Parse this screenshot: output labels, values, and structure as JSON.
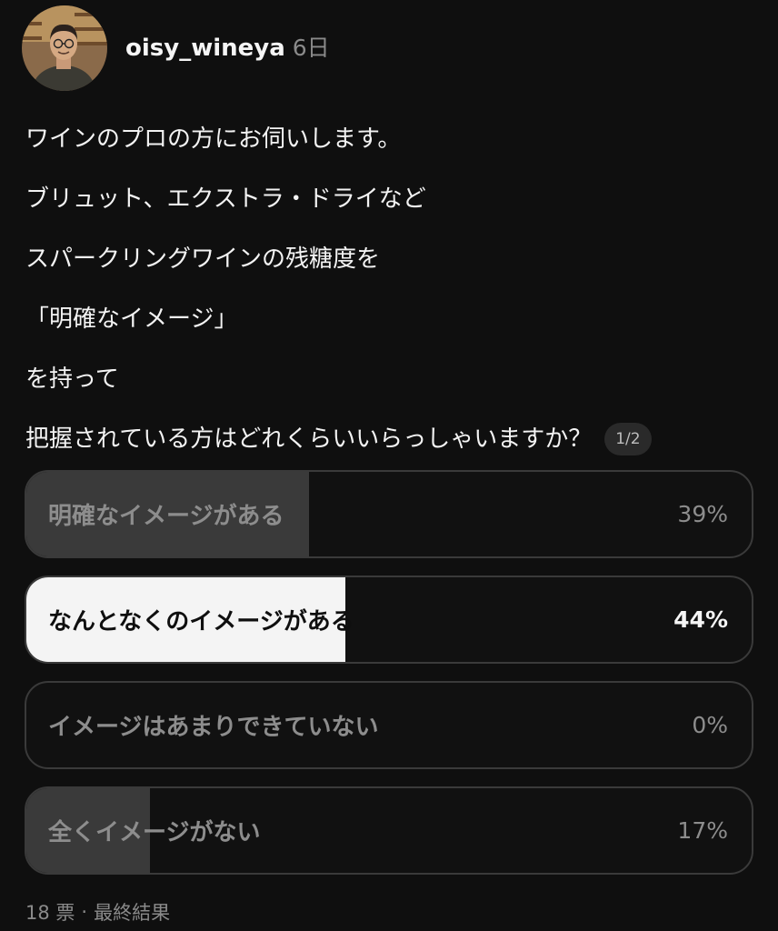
{
  "post": {
    "author": "oisy_wineya",
    "time": "6日",
    "lines": [
      "ワインのプロの方にお伺いします。",
      "ブリュット、エクストラ・ドライなど",
      "スパークリングワインの残糖度を",
      "「明確なイメージ」",
      "を持って",
      "把握されている方はどれくらいいらっしゃいますか？"
    ],
    "page_indicator": "1/2"
  },
  "poll": {
    "options": [
      {
        "label": "明確なイメージがある",
        "percent_text": "39%",
        "percent": 39,
        "selected": false
      },
      {
        "label": "なんとなくのイメージがある",
        "percent_text": "44%",
        "percent": 44,
        "selected": true
      },
      {
        "label": "イメージはあまりできていない",
        "percent_text": "0%",
        "percent": 0,
        "selected": false
      },
      {
        "label": "全くイメージがない",
        "percent_text": "17%",
        "percent": 17,
        "selected": false
      }
    ],
    "votes": "18 票",
    "separator": "·",
    "status": "最終結果"
  },
  "colors": {
    "background": "#0f0f0f",
    "result_fill": "#3a3a3a",
    "selected_fill": "#f4f4f4",
    "muted_text": "#8d8d8d"
  },
  "icons": {
    "avatar": "profile-photo"
  }
}
